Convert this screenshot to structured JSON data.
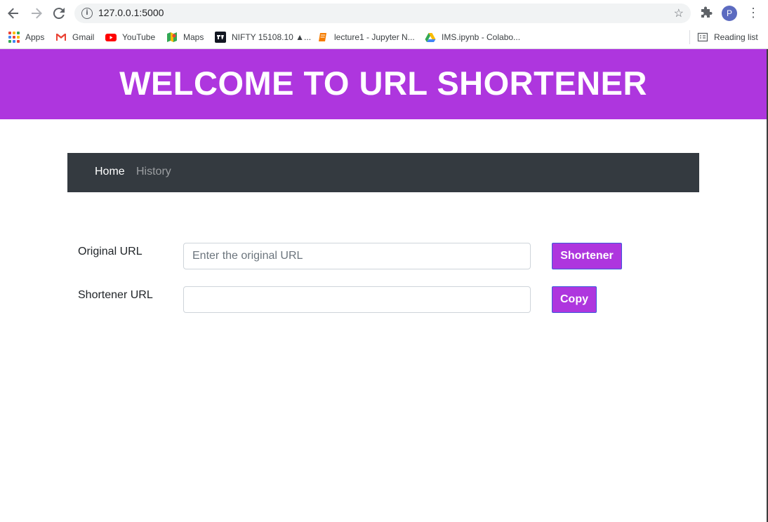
{
  "browser": {
    "url": "127.0.0.1:5000",
    "bookmarks": [
      {
        "label": "Apps",
        "icon": "apps-grid-icon"
      },
      {
        "label": "Gmail",
        "icon": "gmail-icon"
      },
      {
        "label": "YouTube",
        "icon": "youtube-icon"
      },
      {
        "label": "Maps",
        "icon": "maps-icon"
      },
      {
        "label": "NIFTY 15108.10 ▲...",
        "icon": "tradingview-icon"
      },
      {
        "label": "lecture1 - Jupyter N...",
        "icon": "notebook-icon"
      },
      {
        "label": "IMS.ipynb - Colabo...",
        "icon": "drive-icon"
      }
    ],
    "reading_list": "Reading list",
    "profile_initial": "P"
  },
  "header": {
    "title": "WELCOME TO URL SHORTENER",
    "bg_color": "#ae36de"
  },
  "navbar": {
    "items": [
      {
        "label": "Home",
        "active": true
      },
      {
        "label": "History",
        "active": false
      }
    ]
  },
  "form": {
    "original": {
      "label": "Original URL",
      "placeholder": "Enter the original URL",
      "value": "",
      "button": "Shortener"
    },
    "shortened": {
      "label": "Shortener URL",
      "value": "",
      "button": "Copy"
    }
  },
  "colors": {
    "accent": "#ae36de",
    "navbar": "#343a40",
    "button_border": "#3b5bdb"
  }
}
